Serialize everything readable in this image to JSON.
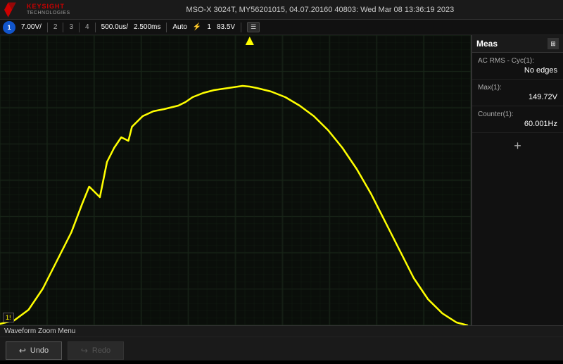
{
  "header": {
    "title": "MSO-X 3024T,  MY56201015,  04.07.20160 40803:  Wed Mar 08  13:36:19  2023",
    "logo_text": "KEYSIGHT\nTECHNOLOGIES"
  },
  "toolbar": {
    "circle_label": "1",
    "ch1_scale": "7.00V/",
    "marker2": "2",
    "marker3": "3",
    "marker4": "4",
    "time_per_div": "500.0us/",
    "time_offset": "2.500ms",
    "trigger_mode": "Auto",
    "trigger_icon": "⚡",
    "trigger_src": "1",
    "trigger_level": "83.5V",
    "menu_icon": "☰"
  },
  "measurements": {
    "title": "Meas",
    "items": [
      {
        "name": "AC RMS - Cyc(1):",
        "value": "No edges"
      },
      {
        "name": "Max(1):",
        "value": "149.72V"
      },
      {
        "name": "Counter(1):",
        "value": "60.001Hz"
      }
    ],
    "add_label": "+"
  },
  "bottom": {
    "menu_label": "Waveform Zoom Menu",
    "undo_label": "Undo",
    "redo_label": "Redo",
    "undo_icon": "↩",
    "redo_icon": "↪"
  },
  "colors": {
    "waveform": "#ffff00",
    "grid": "#1a2a1a",
    "grid_line": "#2a3a2a",
    "background": "#000000"
  }
}
